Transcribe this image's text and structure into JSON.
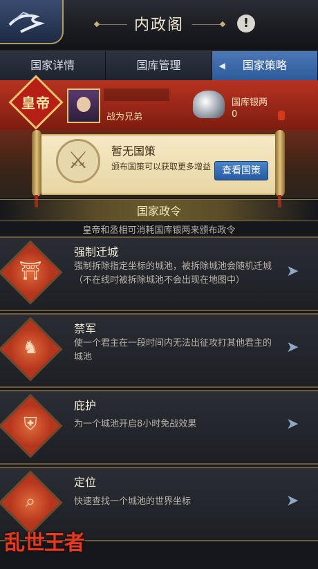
{
  "header": {
    "title": "内政阁",
    "info_icon": "!"
  },
  "tabs": [
    {
      "label": "国家详情",
      "active": false
    },
    {
      "label": "国库管理",
      "active": false
    },
    {
      "label": "国家策略",
      "active": true
    }
  ],
  "emperor": {
    "seal_text": "皇帝",
    "name": "战为兄弟",
    "treasury_label": "国库银两",
    "treasury_value": "0"
  },
  "policy": {
    "title": "暂无国策",
    "description": "颁布国策可以获取更多增益",
    "button_label": "查看国策",
    "emblem_icon": "crossed-swords-icon"
  },
  "decree_section": {
    "title": "国家政令",
    "subtitle": "皇帝和丞相可消耗国库银两来颁布政令"
  },
  "decrees": [
    {
      "title": "强制迁城",
      "description": "强制拆除指定坐标的城池，被拆除城池会随机迁城（不在线时被拆除城池不会出现在地图中）",
      "icon": "relocate-city-icon"
    },
    {
      "title": "禁军",
      "description": "使一个君主在一段时间内无法出征攻打其他君主的城池",
      "icon": "imperial-guard-icon"
    },
    {
      "title": "庇护",
      "description": "为一个城池开启8小时免战效果",
      "icon": "shelter-icon"
    },
    {
      "title": "定位",
      "description": "快速查找一个城池的世界坐标",
      "icon": "locate-icon"
    }
  ],
  "logo": {
    "text": "乱世王者"
  },
  "colors": {
    "accent_blue": "#3a6fb5",
    "emperor_red": "#b8331f",
    "gold": "#c9ab6a"
  }
}
